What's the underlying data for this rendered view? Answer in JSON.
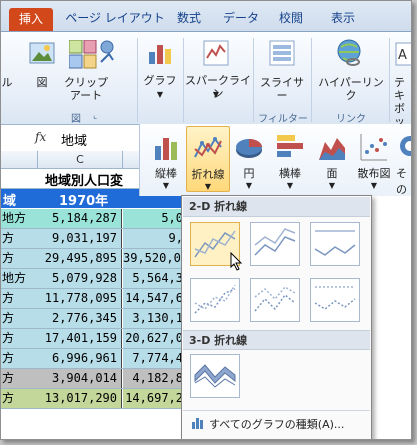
{
  "ribbon": {
    "tabs": [
      "挿入",
      "ページ レイアウト",
      "数式",
      "データ",
      "校閲",
      "表示"
    ],
    "active_tab": "挿入",
    "buttons": {
      "picture": "図",
      "clipart_line1": "クリップ",
      "clipart_line2": "アート",
      "graph": "グラフ",
      "sparkline": "スパークライン",
      "slicer": "スライサー",
      "hyperlink": "ハイパーリンク",
      "text_partial": "テキ",
      "box_partial": "ボッ"
    },
    "groups": {
      "figure": "図",
      "filter": "フィルター",
      "link": "リンク"
    }
  },
  "formula_bar": {
    "fx": "fx",
    "value": "地域"
  },
  "sheet": {
    "col_c": "C",
    "title_partial": "地域別人口変",
    "header_a": "域",
    "header_c": "1970年",
    "rows": [
      {
        "a": "地方",
        "c": "5,184,287",
        "d": "5,0"
      },
      {
        "a": "方",
        "c": "9,031,197",
        "d": "9,"
      },
      {
        "a": "方",
        "c": "29,495,895",
        "d": "39,520,05"
      },
      {
        "a": "地方",
        "c": "5,079,928",
        "d": "5,564,3"
      },
      {
        "a": "方",
        "c": "11,778,095",
        "d": "14,547,6"
      },
      {
        "a": "方",
        "c": "2,776,345",
        "d": "3,130,1"
      },
      {
        "a": "方",
        "c": "17,401,159",
        "d": "20,627,0"
      },
      {
        "a": "方",
        "c": "6,996,961",
        "d": "7,774,4"
      },
      {
        "a": "方",
        "c": "3,904,014",
        "d": "4,182,8"
      },
      {
        "a": "方",
        "c": "13,017,290",
        "d": "14,697,2"
      }
    ],
    "row_colors": [
      "#99e3d8",
      "#b6dde8",
      "#b6dde8",
      "#b6dde8",
      "#b6dde8",
      "#b6dde8",
      "#b6dde8",
      "#b6dde8",
      "#bfbfbf",
      "#c4d79b"
    ]
  },
  "chart_types": [
    "縦棒",
    "折れ線",
    "円",
    "横棒",
    "面",
    "散布図",
    "その"
  ],
  "dropdown": {
    "header_2d": "2-D 折れ線",
    "header_3d": "3-D 折れ線",
    "footer": "すべてのグラフの種類(A)..."
  },
  "colors": {
    "accent_tab": "#d2481a",
    "selection": "#ffd87a",
    "header_fill": "#1f6bd8"
  }
}
